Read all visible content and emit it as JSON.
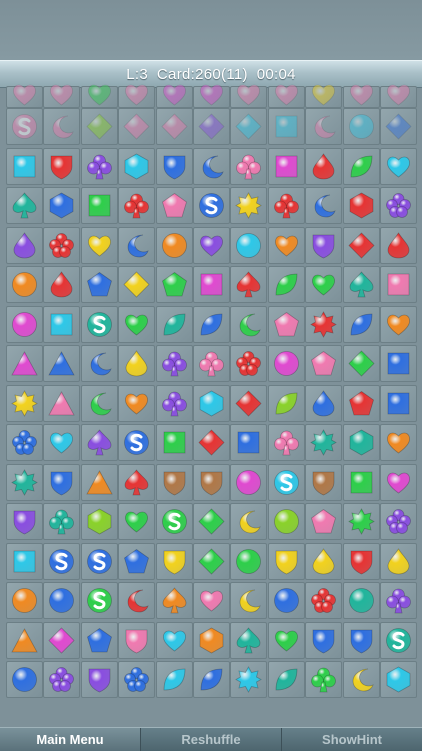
{
  "status": {
    "text": "L:3  Card:260(11)  00:04"
  },
  "bottom_menu": {
    "main_menu": "Main Menu",
    "reshuffle": "Reshuffle",
    "show_hint": "ShowHint"
  },
  "palette": {
    "cyan": "#2ec8e8",
    "red": "#e63434",
    "purple": "#8a4ee0",
    "magenta": "#e04ad0",
    "blue": "#2f6fe0",
    "yellow": "#f2d21e",
    "green": "#2ecf4a",
    "orange": "#f08a22",
    "teal": "#21b59c",
    "pink": "#f07ab0",
    "lime": "#8ad22a",
    "navy": "#3a4fd0",
    "peach": "#f0a070",
    "brown": "#b07848"
  },
  "board": {
    "columns": 11,
    "rows": [
      [
        "pink-heart",
        "pink-heart",
        "green-heart",
        "pink-heart",
        "magenta-heart",
        "magenta-heart",
        "pink-heart",
        "pink-heart",
        "yellow-heart",
        "pink-heart",
        "pink-heart"
      ],
      [
        "pink-s",
        "pink-moon",
        "lime-diamond",
        "pink-diamond",
        "pink-diamond",
        "purple-diamond",
        "cyan-diamond",
        "cyan-square",
        "pink-moon",
        "cyan-circle",
        "blue-diamond"
      ],
      [
        "cyan-square",
        "red-shield",
        "purple-club",
        "cyan-hexagon",
        "blue-shield",
        "blue-moon",
        "pink-club",
        "magenta-square",
        "red-drop",
        "green-leaf",
        "cyan-heart"
      ],
      [
        "teal-spade",
        "blue-hexagon",
        "green-square",
        "red-club",
        "pink-pentagon",
        "blue-s",
        "yellow-star",
        "red-club",
        "blue-moon",
        "red-hexagon",
        "purple-clover"
      ],
      [
        "purple-drop",
        "red-clover",
        "yellow-heart",
        "blue-moon",
        "orange-circle",
        "purple-heart",
        "cyan-circle",
        "orange-heart",
        "purple-shield",
        "red-diamond",
        "red-drop"
      ],
      [
        "orange-circle",
        "red-drop",
        "blue-pentagon",
        "yellow-diamond",
        "green-pentagon",
        "magenta-square",
        "red-spade",
        "green-leaf",
        "green-heart",
        "teal-spade",
        "pink-square"
      ],
      [
        "magenta-circle",
        "cyan-square",
        "teal-s",
        "green-heart",
        "teal-leaf",
        "blue-leaf",
        "green-moon",
        "pink-pentagon",
        "red-star",
        "blue-leaf",
        "orange-heart"
      ],
      [
        "magenta-triangle",
        "blue-triangle",
        "blue-moon",
        "yellow-drop",
        "purple-club",
        "pink-club",
        "red-clover",
        "magenta-circle",
        "pink-pentagon",
        "green-diamond",
        "blue-square"
      ],
      [
        "yellow-star",
        "pink-triangle",
        "green-moon",
        "orange-heart",
        "purple-club",
        "cyan-hexagon",
        "red-diamond",
        "lime-leaf",
        "blue-drop",
        "red-pentagon",
        "blue-square"
      ],
      [
        "blue-clover",
        "cyan-heart",
        "purple-spade",
        "blue-s",
        "green-square",
        "red-diamond",
        "blue-square",
        "pink-club",
        "teal-star",
        "teal-hexagon",
        "orange-heart"
      ],
      [
        "teal-star",
        "blue-shield",
        "orange-triangle",
        "red-spade",
        "brown-shield",
        "brown-shield",
        "magenta-circle",
        "cyan-s",
        "brown-shield",
        "green-square",
        "magenta-heart"
      ],
      [
        "purple-shield",
        "teal-club",
        "lime-hexagon",
        "green-heart",
        "green-s",
        "green-diamond",
        "yellow-moon",
        "lime-circle",
        "pink-pentagon",
        "green-star",
        "purple-clover"
      ],
      [
        "cyan-square",
        "blue-s",
        "blue-s",
        "blue-pentagon",
        "yellow-shield",
        "green-diamond",
        "green-circle",
        "yellow-shield",
        "yellow-drop",
        "red-shield",
        "yellow-drop"
      ],
      [
        "orange-circle",
        "blue-circle",
        "green-s",
        "red-moon",
        "orange-spade",
        "pink-heart",
        "yellow-moon",
        "blue-circle",
        "red-clover",
        "teal-circle",
        "purple-club"
      ],
      [
        "orange-triangle",
        "magenta-diamond",
        "blue-pentagon",
        "pink-shield",
        "cyan-heart",
        "orange-hexagon",
        "teal-spade",
        "green-heart",
        "blue-shield",
        "blue-shield",
        "teal-s"
      ],
      [
        "blue-circle",
        "purple-clover",
        "purple-shield",
        "blue-clover",
        "cyan-leaf",
        "blue-leaf",
        "cyan-star",
        "teal-leaf",
        "green-club",
        "yellow-moon",
        "cyan-hexagon"
      ]
    ]
  }
}
